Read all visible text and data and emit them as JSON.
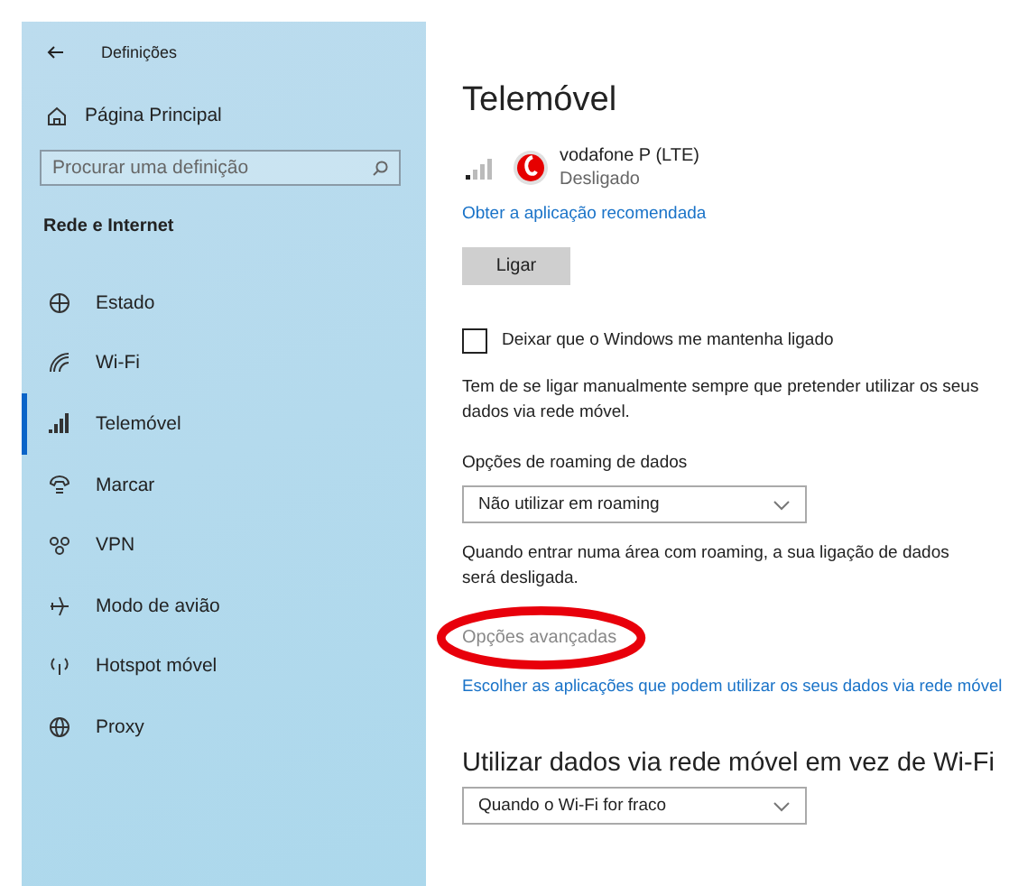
{
  "window": {
    "title": "Definições"
  },
  "sidebar": {
    "home": "Página Principal",
    "search": {
      "placeholder": "Procurar uma definição"
    },
    "section": "Rede e Internet",
    "items": [
      {
        "label": "Estado",
        "kind": "status",
        "selected": false
      },
      {
        "label": "Wi-Fi",
        "kind": "wifi",
        "selected": false
      },
      {
        "label": "Telemóvel",
        "kind": "cellular",
        "selected": true
      },
      {
        "label": "Marcar",
        "kind": "dialup",
        "selected": false
      },
      {
        "label": "VPN",
        "kind": "vpn",
        "selected": false
      },
      {
        "label": "Modo de avião",
        "kind": "airplane",
        "selected": false
      },
      {
        "label": "Hotspot móvel",
        "kind": "hotspot",
        "selected": false
      },
      {
        "label": "Proxy",
        "kind": "proxy",
        "selected": false
      }
    ]
  },
  "content": {
    "title": "Telemóvel",
    "network": {
      "name": "vodafone P (LTE)",
      "status": "Desligado"
    },
    "app_link": "Obter a aplicação recomendada",
    "connect_button": "Ligar",
    "keep_connected": {
      "label": "Deixar que o Windows me mantenha ligado",
      "checked": false
    },
    "manual_note": "Tem de se ligar manualmente sempre que pretender utilizar os seus dados via rede móvel.",
    "roaming": {
      "label": "Opções de roaming de dados",
      "value": "Não utilizar em roaming",
      "note": "Quando entrar numa área com roaming, a sua ligação de dados será desligada."
    },
    "advanced": "Opções avançadas",
    "apps_link": "Escolher as aplicações que podem utilizar os seus dados via rede móvel",
    "wifi_section": {
      "title": "Utilizar dados via rede móvel em vez de Wi-Fi",
      "value": "Quando o Wi-Fi for fraco"
    }
  }
}
